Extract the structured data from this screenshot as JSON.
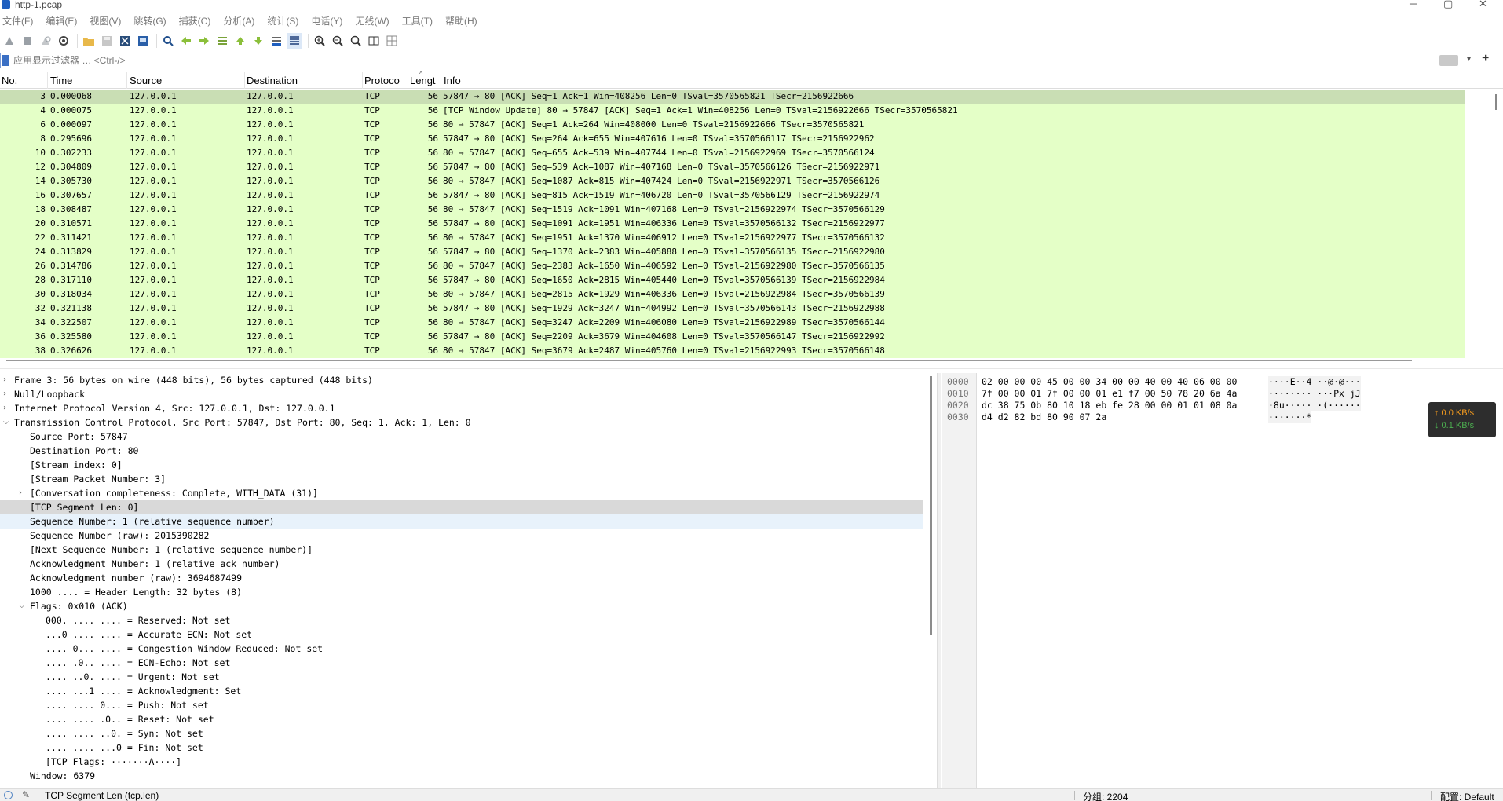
{
  "window": {
    "title": "http-1.pcap"
  },
  "menu": [
    "文件(F)",
    "编辑(E)",
    "视图(V)",
    "跳转(G)",
    "捕获(C)",
    "分析(A)",
    "统计(S)",
    "电话(Y)",
    "无线(W)",
    "工具(T)",
    "帮助(H)"
  ],
  "toolbar": {
    "icons": [
      "start-capture-icon",
      "stop-capture-icon",
      "restart-capture-icon",
      "capture-options-icon",
      "open-file-icon",
      "save-file-icon",
      "close-file-icon",
      "reload-file-icon",
      "find-packet-icon",
      "go-back-icon",
      "go-forward-icon",
      "go-to-packet-icon",
      "go-first-icon",
      "go-last-icon",
      "auto-scroll-icon",
      "colorize-icon",
      "zoom-in-icon",
      "zoom-out-icon",
      "normal-size-icon",
      "resize-columns-icon",
      "layout-icon"
    ]
  },
  "filter": {
    "placeholder": "应用显示过滤器 … <Ctrl-/>",
    "value": ""
  },
  "packet_list": {
    "columns": [
      "No.",
      "Time",
      "Source",
      "Destination",
      "Protoco",
      "Lengt",
      "Info"
    ],
    "rows": [
      {
        "no": "3",
        "time": "0.000068",
        "src": "127.0.0.1",
        "dst": "127.0.0.1",
        "proto": "TCP",
        "len": "56",
        "info": "57847 → 80 [ACK] Seq=1 Ack=1 Win=408256 Len=0 TSval=3570565821 TSecr=2156922666"
      },
      {
        "no": "4",
        "time": "0.000075",
        "src": "127.0.0.1",
        "dst": "127.0.0.1",
        "proto": "TCP",
        "len": "56",
        "info": "[TCP Window Update] 80 → 57847 [ACK] Seq=1 Ack=1 Win=408256 Len=0 TSval=2156922666 TSecr=3570565821"
      },
      {
        "no": "6",
        "time": "0.000097",
        "src": "127.0.0.1",
        "dst": "127.0.0.1",
        "proto": "TCP",
        "len": "56",
        "info": "80 → 57847 [ACK] Seq=1 Ack=264 Win=408000 Len=0 TSval=2156922666 TSecr=3570565821"
      },
      {
        "no": "8",
        "time": "0.295696",
        "src": "127.0.0.1",
        "dst": "127.0.0.1",
        "proto": "TCP",
        "len": "56",
        "info": "57847 → 80 [ACK] Seq=264 Ack=655 Win=407616 Len=0 TSval=3570566117 TSecr=2156922962"
      },
      {
        "no": "10",
        "time": "0.302233",
        "src": "127.0.0.1",
        "dst": "127.0.0.1",
        "proto": "TCP",
        "len": "56",
        "info": "80 → 57847 [ACK] Seq=655 Ack=539 Win=407744 Len=0 TSval=2156922969 TSecr=3570566124"
      },
      {
        "no": "12",
        "time": "0.304809",
        "src": "127.0.0.1",
        "dst": "127.0.0.1",
        "proto": "TCP",
        "len": "56",
        "info": "57847 → 80 [ACK] Seq=539 Ack=1087 Win=407168 Len=0 TSval=3570566126 TSecr=2156922971"
      },
      {
        "no": "14",
        "time": "0.305730",
        "src": "127.0.0.1",
        "dst": "127.0.0.1",
        "proto": "TCP",
        "len": "56",
        "info": "80 → 57847 [ACK] Seq=1087 Ack=815 Win=407424 Len=0 TSval=2156922971 TSecr=3570566126"
      },
      {
        "no": "16",
        "time": "0.307657",
        "src": "127.0.0.1",
        "dst": "127.0.0.1",
        "proto": "TCP",
        "len": "56",
        "info": "57847 → 80 [ACK] Seq=815 Ack=1519 Win=406720 Len=0 TSval=3570566129 TSecr=2156922974"
      },
      {
        "no": "18",
        "time": "0.308487",
        "src": "127.0.0.1",
        "dst": "127.0.0.1",
        "proto": "TCP",
        "len": "56",
        "info": "80 → 57847 [ACK] Seq=1519 Ack=1091 Win=407168 Len=0 TSval=2156922974 TSecr=3570566129"
      },
      {
        "no": "20",
        "time": "0.310571",
        "src": "127.0.0.1",
        "dst": "127.0.0.1",
        "proto": "TCP",
        "len": "56",
        "info": "57847 → 80 [ACK] Seq=1091 Ack=1951 Win=406336 Len=0 TSval=3570566132 TSecr=2156922977"
      },
      {
        "no": "22",
        "time": "0.311421",
        "src": "127.0.0.1",
        "dst": "127.0.0.1",
        "proto": "TCP",
        "len": "56",
        "info": "80 → 57847 [ACK] Seq=1951 Ack=1370 Win=406912 Len=0 TSval=2156922977 TSecr=3570566132"
      },
      {
        "no": "24",
        "time": "0.313829",
        "src": "127.0.0.1",
        "dst": "127.0.0.1",
        "proto": "TCP",
        "len": "56",
        "info": "57847 → 80 [ACK] Seq=1370 Ack=2383 Win=405888 Len=0 TSval=3570566135 TSecr=2156922980"
      },
      {
        "no": "26",
        "time": "0.314786",
        "src": "127.0.0.1",
        "dst": "127.0.0.1",
        "proto": "TCP",
        "len": "56",
        "info": "80 → 57847 [ACK] Seq=2383 Ack=1650 Win=406592 Len=0 TSval=2156922980 TSecr=3570566135"
      },
      {
        "no": "28",
        "time": "0.317110",
        "src": "127.0.0.1",
        "dst": "127.0.0.1",
        "proto": "TCP",
        "len": "56",
        "info": "57847 → 80 [ACK] Seq=1650 Ack=2815 Win=405440 Len=0 TSval=3570566139 TSecr=2156922984"
      },
      {
        "no": "30",
        "time": "0.318034",
        "src": "127.0.0.1",
        "dst": "127.0.0.1",
        "proto": "TCP",
        "len": "56",
        "info": "80 → 57847 [ACK] Seq=2815 Ack=1929 Win=406336 Len=0 TSval=2156922984 TSecr=3570566139"
      },
      {
        "no": "32",
        "time": "0.321138",
        "src": "127.0.0.1",
        "dst": "127.0.0.1",
        "proto": "TCP",
        "len": "56",
        "info": "57847 → 80 [ACK] Seq=1929 Ack=3247 Win=404992 Len=0 TSval=3570566143 TSecr=2156922988"
      },
      {
        "no": "34",
        "time": "0.322507",
        "src": "127.0.0.1",
        "dst": "127.0.0.1",
        "proto": "TCP",
        "len": "56",
        "info": "80 → 57847 [ACK] Seq=3247 Ack=2209 Win=406080 Len=0 TSval=2156922989 TSecr=3570566144"
      },
      {
        "no": "36",
        "time": "0.325580",
        "src": "127.0.0.1",
        "dst": "127.0.0.1",
        "proto": "TCP",
        "len": "56",
        "info": "57847 → 80 [ACK] Seq=2209 Ack=3679 Win=404608 Len=0 TSval=3570566147 TSecr=2156922992"
      },
      {
        "no": "38",
        "time": "0.326626",
        "src": "127.0.0.1",
        "dst": "127.0.0.1",
        "proto": "TCP",
        "len": "56",
        "info": "80 → 57847 [ACK] Seq=3679 Ack=2487 Win=405760 Len=0 TSval=2156922993 TSecr=3570566148"
      }
    ]
  },
  "details": [
    {
      "indent": 0,
      "arrow": "right",
      "text": "Frame 3: 56 bytes on wire (448 bits), 56 bytes captured (448 bits)"
    },
    {
      "indent": 0,
      "arrow": "right",
      "text": "Null/Loopback"
    },
    {
      "indent": 0,
      "arrow": "right",
      "text": "Internet Protocol Version 4, Src: 127.0.0.1, Dst: 127.0.0.1"
    },
    {
      "indent": 0,
      "arrow": "down",
      "text": "Transmission Control Protocol, Src Port: 57847, Dst Port: 80, Seq: 1, Ack: 1, Len: 0"
    },
    {
      "indent": 1,
      "arrow": "",
      "text": "Source Port: 57847"
    },
    {
      "indent": 1,
      "arrow": "",
      "text": "Destination Port: 80"
    },
    {
      "indent": 1,
      "arrow": "",
      "text": "[Stream index: 0]"
    },
    {
      "indent": 1,
      "arrow": "",
      "text": "[Stream Packet Number: 3]"
    },
    {
      "indent": 1,
      "arrow": "right",
      "text": "[Conversation completeness: Complete, WITH_DATA (31)]"
    },
    {
      "indent": 1,
      "arrow": "",
      "text": "[TCP Segment Len: 0]",
      "state": "selected"
    },
    {
      "indent": 1,
      "arrow": "",
      "text": "Sequence Number: 1    (relative sequence number)",
      "state": "hover"
    },
    {
      "indent": 1,
      "arrow": "",
      "text": "Sequence Number (raw): 2015390282"
    },
    {
      "indent": 1,
      "arrow": "",
      "text": "[Next Sequence Number: 1    (relative sequence number)]"
    },
    {
      "indent": 1,
      "arrow": "",
      "text": "Acknowledgment Number: 1    (relative ack number)"
    },
    {
      "indent": 1,
      "arrow": "",
      "text": "Acknowledgment number (raw): 3694687499"
    },
    {
      "indent": 1,
      "arrow": "",
      "text": "1000 .... = Header Length: 32 bytes (8)"
    },
    {
      "indent": 1,
      "arrow": "down",
      "text": "Flags: 0x010 (ACK)"
    },
    {
      "indent": 2,
      "arrow": "",
      "text": "000. .... .... = Reserved: Not set"
    },
    {
      "indent": 2,
      "arrow": "",
      "text": "...0 .... .... = Accurate ECN: Not set"
    },
    {
      "indent": 2,
      "arrow": "",
      "text": ".... 0... .... = Congestion Window Reduced: Not set"
    },
    {
      "indent": 2,
      "arrow": "",
      "text": ".... .0.. .... = ECN-Echo: Not set"
    },
    {
      "indent": 2,
      "arrow": "",
      "text": ".... ..0. .... = Urgent: Not set"
    },
    {
      "indent": 2,
      "arrow": "",
      "text": ".... ...1 .... = Acknowledgment: Set"
    },
    {
      "indent": 2,
      "arrow": "",
      "text": ".... .... 0... = Push: Not set"
    },
    {
      "indent": 2,
      "arrow": "",
      "text": ".... .... .0.. = Reset: Not set"
    },
    {
      "indent": 2,
      "arrow": "",
      "text": ".... .... ..0. = Syn: Not set"
    },
    {
      "indent": 2,
      "arrow": "",
      "text": ".... .... ...0 = Fin: Not set"
    },
    {
      "indent": 2,
      "arrow": "",
      "text": "[TCP Flags: ·······A····]"
    },
    {
      "indent": 1,
      "arrow": "",
      "text": "Window: 6379"
    }
  ],
  "bytes": [
    {
      "offset": "0000",
      "hex": "02 00 00 00 45 00 00 34  00 00 40 00 40 06 00 00",
      "ascii": "····E··4 ··@·@···"
    },
    {
      "offset": "0010",
      "hex": "7f 00 00 01 7f 00 00 01  e1 f7 00 50 78 20 6a 4a",
      "ascii": "········ ···Px jJ"
    },
    {
      "offset": "0020",
      "hex": "dc 38 75 0b 80 10 18 eb  fe 28 00 00 01 01 08 0a",
      "ascii": "·8u····· ·(······"
    },
    {
      "offset": "0030",
      "hex": "d4 d2 82 bd 80 90 07 2a",
      "ascii": "·······*"
    }
  ],
  "netspeed": {
    "up": "↑ 0.0 KB/s",
    "down": "↓ 0.1 KB/s"
  },
  "status": {
    "field": "TCP Segment Len (tcp.len)",
    "packets": "分组: 2204",
    "profile": "配置: Default"
  },
  "colors": {
    "row_bg": "#e4ffc7",
    "row_selected": "#c9deb4",
    "tree_selected": "#d9d9d9"
  }
}
